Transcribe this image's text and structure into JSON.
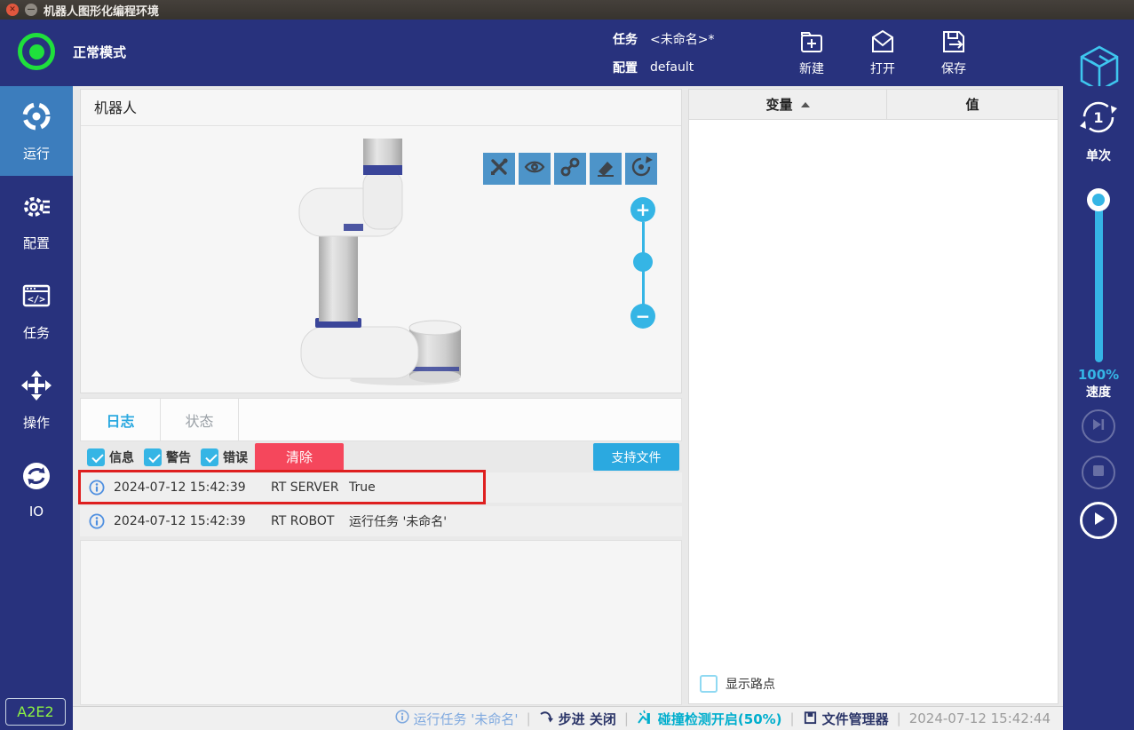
{
  "window": {
    "title": "机器人图形化编程环境"
  },
  "header": {
    "mode_label": "正常模式",
    "task_label": "任务",
    "task_value": "<未命名>*",
    "config_label": "配置",
    "config_value": "default",
    "new_label": "新建",
    "open_label": "打开",
    "save_label": "保存"
  },
  "sidebar": {
    "items": [
      {
        "label": "运行",
        "active": true
      },
      {
        "label": "配置",
        "active": false
      },
      {
        "label": "任务",
        "active": false
      },
      {
        "label": "操作",
        "active": false
      },
      {
        "label": "IO",
        "active": false
      }
    ],
    "badge": "A2E2"
  },
  "robot_panel": {
    "title": "机器人"
  },
  "log_panel": {
    "tab_log": "日志",
    "tab_status": "状态",
    "filters": [
      {
        "label": "信息",
        "checked": true
      },
      {
        "label": "警告",
        "checked": true
      },
      {
        "label": "错误",
        "checked": true
      }
    ],
    "clear_label": "清除",
    "support_label": "支持文件",
    "entries": [
      {
        "time": "2024-07-12 15:42:39",
        "source": "RT SERVER",
        "message": "True",
        "highlighted": true
      },
      {
        "time": "2024-07-12 15:42:39",
        "source": "RT ROBOT",
        "message": "运行任务 '未命名'",
        "highlighted": false
      }
    ]
  },
  "var_panel": {
    "col_variable": "变量",
    "col_value": "值",
    "show_waypoints": {
      "label": "显示路点",
      "checked": false
    }
  },
  "right_sidebar": {
    "single_label": "单次",
    "single_count": "1",
    "speed_percent": "100%",
    "speed_label": "速度"
  },
  "status_bar": {
    "running_task": "运行任务 '未命名'",
    "step_label": "步进 关闭",
    "collision_label": "碰撞检测开启(50%)",
    "file_manager_label": "文件管理器",
    "timestamp": "2024-07-12 15:42:44"
  },
  "colors": {
    "accent_cyan": "#29ABE2",
    "navy": "#28327D",
    "active_item_blue": "#3C7DBD",
    "toolbar_button_blue": "#4D94C9",
    "clear_red": "#F5475C",
    "mode_green": "#1FE03C",
    "annotation_red": "#DE1F1F",
    "status_teal": "#00AECD",
    "badge_green": "#8CF243"
  }
}
